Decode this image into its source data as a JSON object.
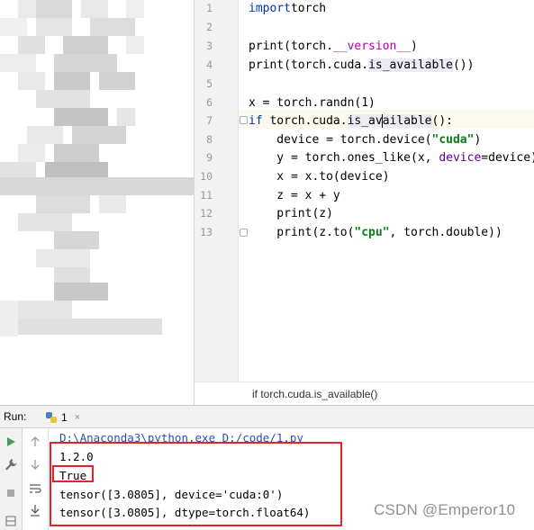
{
  "editor": {
    "line_numbers": [
      "1",
      "2",
      "3",
      "4",
      "5",
      "6",
      "7",
      "8",
      "9",
      "10",
      "11",
      "12",
      "13"
    ],
    "breadcrumb": "if torch.cuda.is_available()"
  },
  "run_panel": {
    "label": "Run:",
    "tab_label": "1",
    "tab_close": "×",
    "console": {
      "command": "D:\\Anaconda3\\python.exe D:/code/1.py",
      "lines": [
        "1.2.0",
        "True",
        "tensor([3.0805], device='cuda:0')",
        "tensor([3.0805], dtype=torch.float64)"
      ]
    },
    "toolbar_icons": [
      "run-icon",
      "wrench-icon",
      "stop-icon",
      "layout-icon",
      "up-arrow-icon",
      "down-arrow-icon",
      "soft-wrap-icon",
      "scroll-to-end-icon"
    ]
  },
  "watermark": "CSDN @Emperor10",
  "colors": {
    "keyword": "#0033b3",
    "string": "#067d17",
    "dunder": "#b200b2",
    "named_param": "#660099",
    "annotation_red": "#e0242b"
  }
}
